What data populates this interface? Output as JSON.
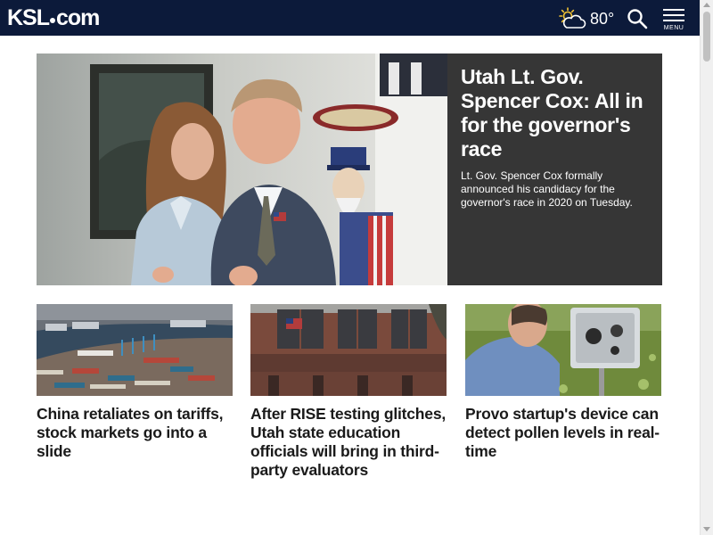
{
  "header": {
    "logo_text": "KSL",
    "logo_suffix": "com",
    "temperature": "80°",
    "weather_icon": "partly-cloudy-sun-icon",
    "search_icon": "search-icon",
    "menu_label": "MENU",
    "background_color": "#0c1a3a"
  },
  "hero": {
    "title": "Utah Lt. Gov. Spencer Cox: All in for the governor's race",
    "summary": "Lt. Gov. Spencer Cox formally announced his candidacy for the governor's race in 2020 on Tuesday.",
    "panel_color": "#363636"
  },
  "cards": [
    {
      "title": "China retaliates on tariffs, stock markets go into a slide"
    },
    {
      "title": "After RISE testing glitches, Utah state education officials will bring in third-party evaluators"
    },
    {
      "title": "Provo startup's device can detect pollen levels in real-time"
    }
  ]
}
